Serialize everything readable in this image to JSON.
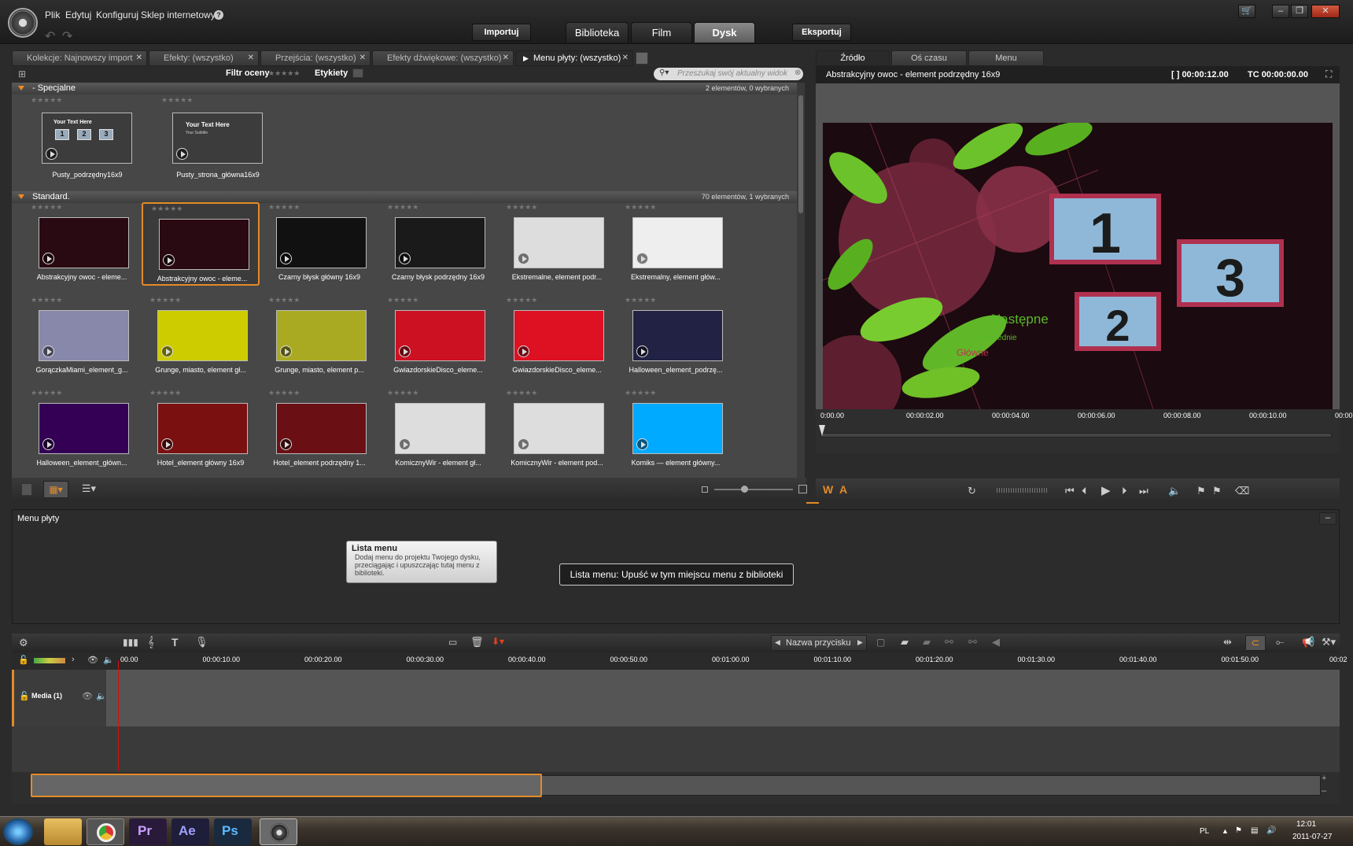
{
  "menubar": {
    "items": [
      "Plik",
      "Edytuj",
      "Konfiguruj",
      "Sklep internetowy"
    ]
  },
  "toolbar": {
    "import": "Importuj",
    "export": "Eksportuj"
  },
  "main_tabs": [
    "Biblioteka",
    "Film",
    "Dysk"
  ],
  "library": {
    "tabs": [
      "Kolekcje: Najnowszy import",
      "Efekty: (wszystko)",
      "Przejścia: (wszystko)",
      "Efekty dźwiękowe: (wszystko)",
      "Menu płyty: (wszystko)"
    ],
    "filter_label": "Filtr oceny",
    "tags_label": "Etykiety",
    "search_placeholder": "Przeszukaj swój aktualny widok",
    "groups": [
      {
        "name": "- Specjalne",
        "count": "2 elementów, 0 wybranych",
        "items": [
          "Pusty_podrzędny16x9",
          "Pusty_strona_główna16x9"
        ]
      },
      {
        "name": "Standard.",
        "count": "70 elementów, 1 wybranych",
        "items": [
          "Abstrakcyjny owoc - eleme...",
          "Abstrakcyjny owoc - eleme...",
          "Czarny błysk główny 16x9",
          "Czarny błysk podrzędny 16x9",
          "Ekstremalne, element podr...",
          "Ekstremalny, element głów...",
          "GorączkaMiami_element_g...",
          "Grunge, miasto, element gł...",
          "Grunge, miasto, element p...",
          "GwiazdorskieDisco_eleme...",
          "GwiazdorskieDisco_eleme...",
          "Halloween_element_podrzę...",
          "Halloween_element_główn...",
          "Hotel_element główny 16x9",
          "Hotel_element podrzędny 1...",
          "KomicznyWir - element gł...",
          "KomicznyWir - element pod...",
          "Komiks — element główny..."
        ]
      }
    ]
  },
  "source": {
    "tabs": [
      "Źródło",
      "Oś czasu",
      "Menu"
    ],
    "title": "Abstrakcyjny owoc - element podrzędny 16x9",
    "duration": "[ ] 00:00:12.00",
    "tc": "TC 00:00:00.00",
    "ruler": [
      "0:00.00",
      "00:00:02.00",
      "00:00:04.00",
      "00:00:06.00",
      "00:00:08.00",
      "00:00:10.00",
      "00:00"
    ],
    "video": {
      "btn1": "1",
      "btn2": "2",
      "btn3": "3",
      "next": "Następne",
      "prev": "Poprzednie",
      "main": "Główne"
    },
    "wa": [
      "W",
      "A"
    ]
  },
  "menu_panel": {
    "title": "Menu płyty",
    "tooltip_title": "Lista menu",
    "tooltip_body": "Dodaj menu do projektu Twojego dysku, przeciągając i upuszczając tutaj menu z biblioteki.",
    "drop_hint": "Lista menu: Upuść w tym miejscu menu z biblioteki"
  },
  "timeline": {
    "button_name": "Nazwa przycisku",
    "track": "Media (1)",
    "ruler": [
      "00.00",
      "00:00:10.00",
      "00:00:20.00",
      "00:00:30.00",
      "00:00:40.00",
      "00:00:50.00",
      "00:01:00.00",
      "00:01:10.00",
      "00:01:20.00",
      "00:01:30.00",
      "00:01:40.00",
      "00:01:50.00",
      "00:02"
    ]
  },
  "taskbar": {
    "lang": "PL",
    "time": "12:01",
    "date": "2011-07-27",
    "apps": [
      "Pr",
      "Ae",
      "Ps"
    ]
  },
  "colors": {
    "accent": "#e38b28",
    "bg": "#2b2b2b"
  }
}
